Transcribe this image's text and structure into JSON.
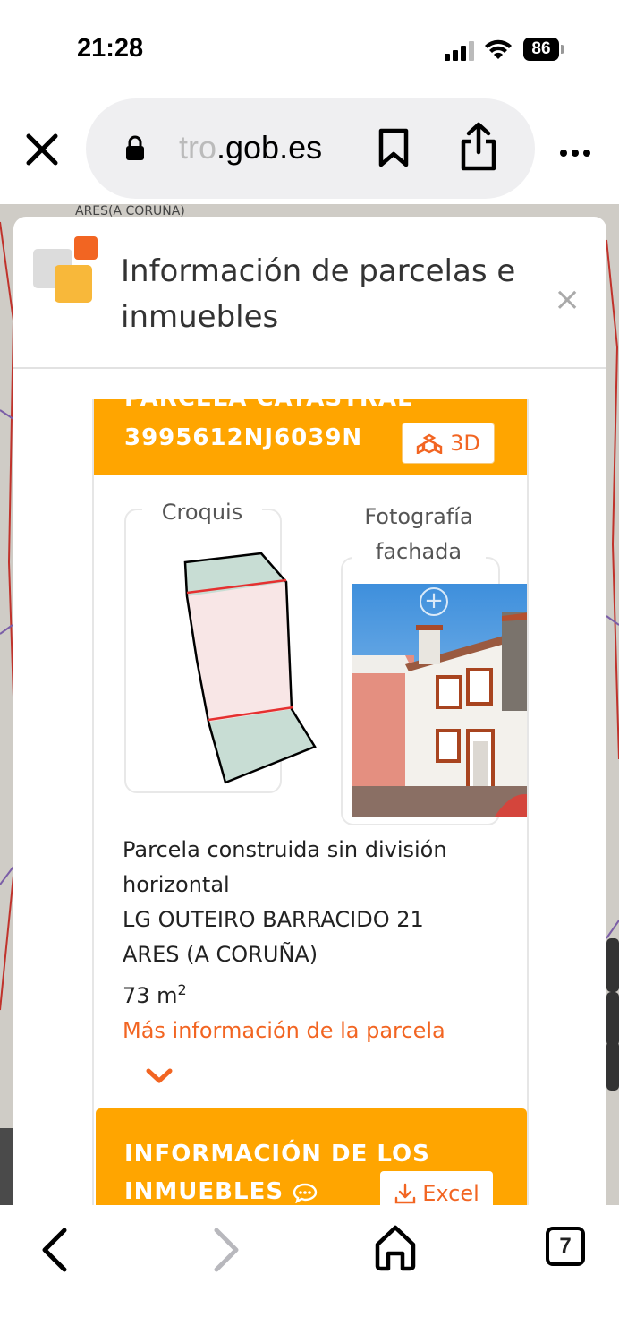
{
  "status": {
    "time": "21:28",
    "battery": "86"
  },
  "browser": {
    "url_faded": "tro",
    "url_main": ".gob.es",
    "tabs_count": "7"
  },
  "map": {
    "top_label": "ARES(A CORUÑA)"
  },
  "panel": {
    "title": "Información de parcelas e inmuebles",
    "close": "×",
    "parcel_label": "PARCELA CATASTRAL",
    "parcel_ref": "3995612NJ6039N",
    "btn_3d": "3D",
    "croquis_label": "Croquis",
    "foto_label": "Fotografía fachada",
    "zoom": "+",
    "desc_line1": "Parcela construida sin división horizontal",
    "address": "LG OUTEIRO BARRACIDO 21",
    "city": "ARES (A CORUÑA)",
    "area": "73 m",
    "area_unit_exp": "2",
    "more_link": "Más información de la parcela",
    "inmuebles_title_1": "INFORMACIÓN DE LOS",
    "inmuebles_title_2": "INMUEBLES",
    "excel_label": "Excel"
  },
  "colors": {
    "accent": "#ffa500",
    "link": "#f26522"
  }
}
